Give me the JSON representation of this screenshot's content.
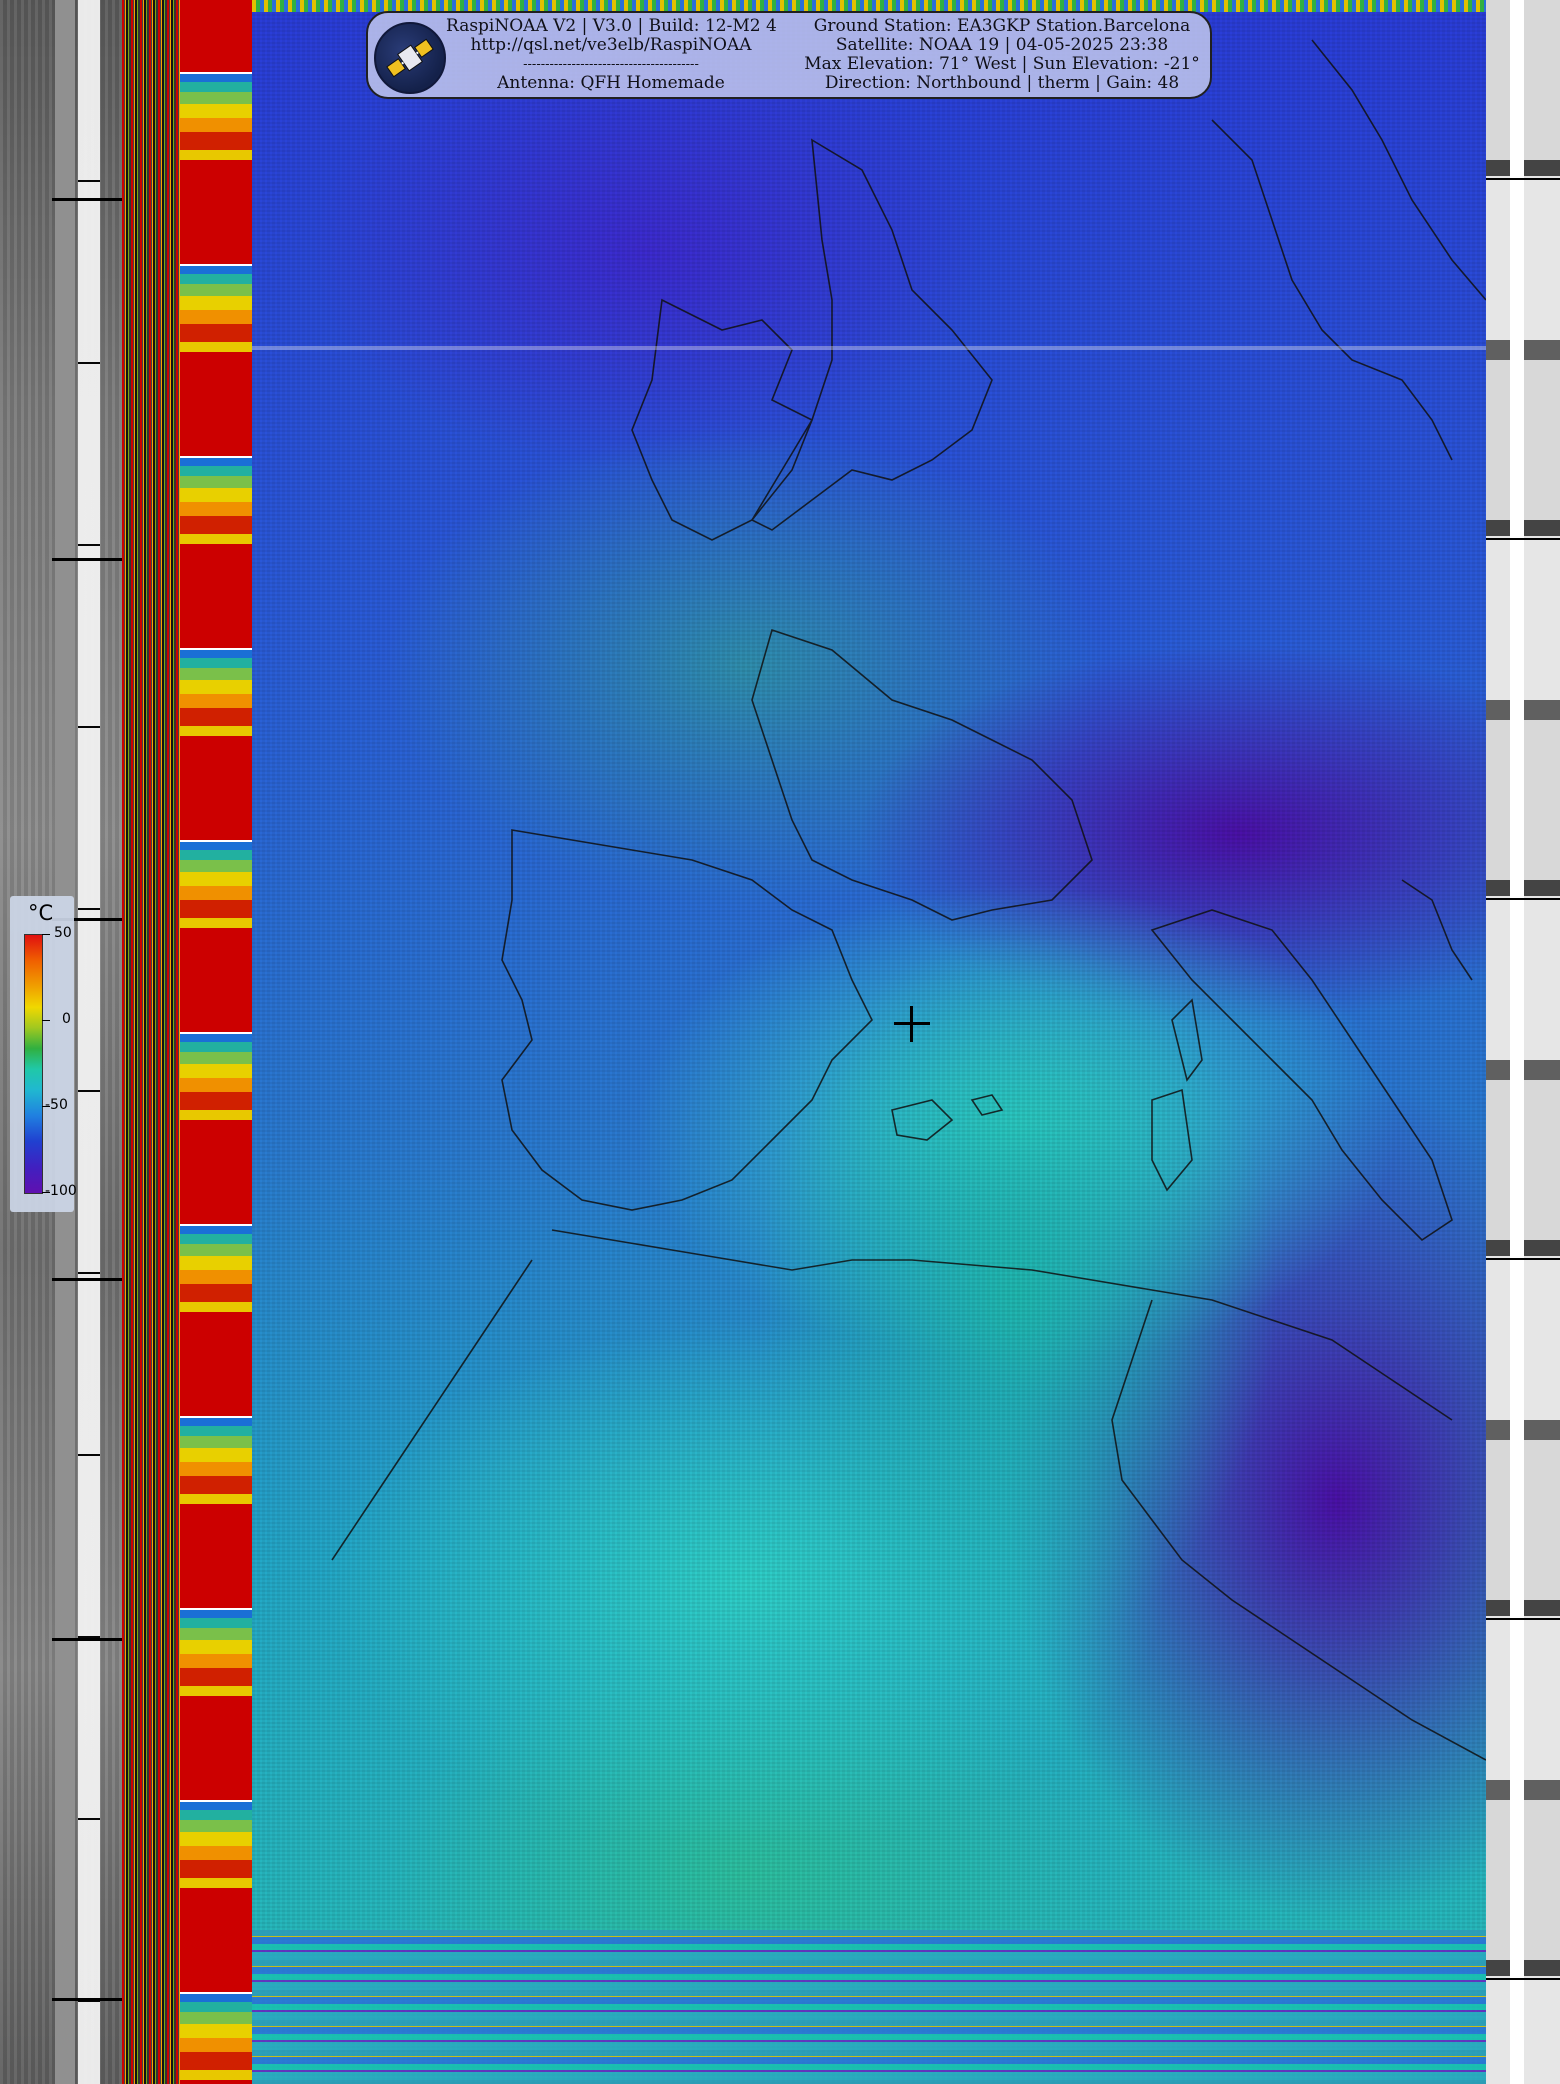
{
  "header": {
    "left_lines": [
      "RaspiNOAA V2 | V3.0 | Build: 12-M2 4",
      "http://qsl.net/ve3elb/RaspiNOAA",
      "----------------------------------------",
      "Antenna: QFH Homemade"
    ],
    "right_lines": [
      "Ground Station: EA3GKP Station.Barcelona",
      "Satellite: NOAA 19 | 04-05-2025 23:38",
      "Max Elevation: 71° West | Sun Elevation: -21°",
      "Direction: Northbound | therm | Gain: 48"
    ]
  },
  "legend": {
    "unit": "°C",
    "labels": [
      {
        "text": "50",
        "value": 50
      },
      {
        "text": "0",
        "value": 0
      },
      {
        "text": "-50",
        "value": -50
      },
      {
        "text": "-100",
        "value": -100
      }
    ],
    "range": [
      50,
      -100
    ],
    "colors": {
      "hot": "#e01010",
      "mid": "#20c8a8",
      "cold": "#6010b0"
    }
  },
  "icons": {
    "logo": "satellite-icon",
    "marker": "crosshair-icon"
  }
}
